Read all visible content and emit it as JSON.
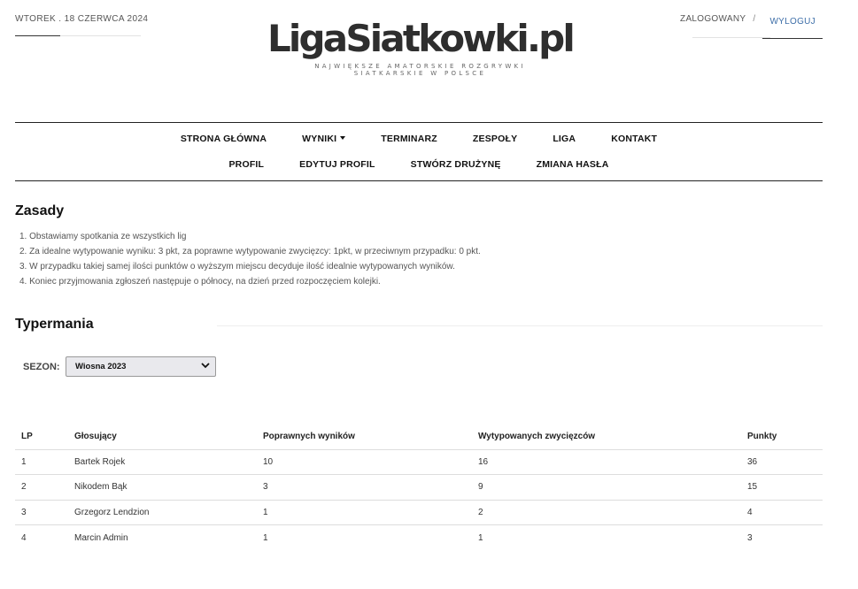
{
  "header": {
    "date": "WTOREK . 18 CZERWCA 2024",
    "logo": "LigaSiatkowki.pl",
    "tagline_line1": "NAJWIĘKSZE AMATORSKIE ROZGRYWKI",
    "tagline_line2": "SIATKARSKIE W POLSCE",
    "logged_in": "ZALOGOWANY",
    "separator": "/",
    "logout": "WYLOGUJ"
  },
  "nav": {
    "row1": [
      "STRONA GŁÓWNA",
      "WYNIKI",
      "TERMINARZ",
      "ZESPOŁY",
      "LIGA",
      "KONTAKT"
    ],
    "row2": [
      "PROFIL",
      "EDYTUJ PROFIL",
      "STWÓRZ DRUŻYNĘ",
      "ZMIANA HASŁA"
    ]
  },
  "rules": {
    "title": "Zasady",
    "items": [
      "1. Obstawiamy spotkania ze wszystkich lig",
      "2. Za idealne wytypowanie wyniku: 3 pkt, za poprawne wytypowanie zwycięzcy: 1pkt, w przeciwnym przypadku: 0 pkt.",
      "3. W przypadku takiej samej ilości punktów o wyższym miejscu decyduje ilość idealnie wytypowanych wyników.",
      "4. Koniec przyjmowania zgłoszeń następuje o północy, na dzień przed rozpoczęciem kolejki."
    ]
  },
  "typermania": {
    "title": "Typermania",
    "season_label": "SEZON:",
    "season_value": "Wiosna 2023",
    "columns": [
      "LP",
      "Głosujący",
      "Poprawnych wyników",
      "Wytypowanych zwycięzców",
      "Punkty"
    ],
    "rows": [
      [
        "1",
        "Bartek Rojek",
        "10",
        "16",
        "36"
      ],
      [
        "2",
        "Nikodem Bąk",
        "3",
        "9",
        "15"
      ],
      [
        "3",
        "Grzegorz Lendzion",
        "1",
        "2",
        "4"
      ],
      [
        "4",
        "Marcin Admin",
        "1",
        "1",
        "3"
      ]
    ]
  }
}
